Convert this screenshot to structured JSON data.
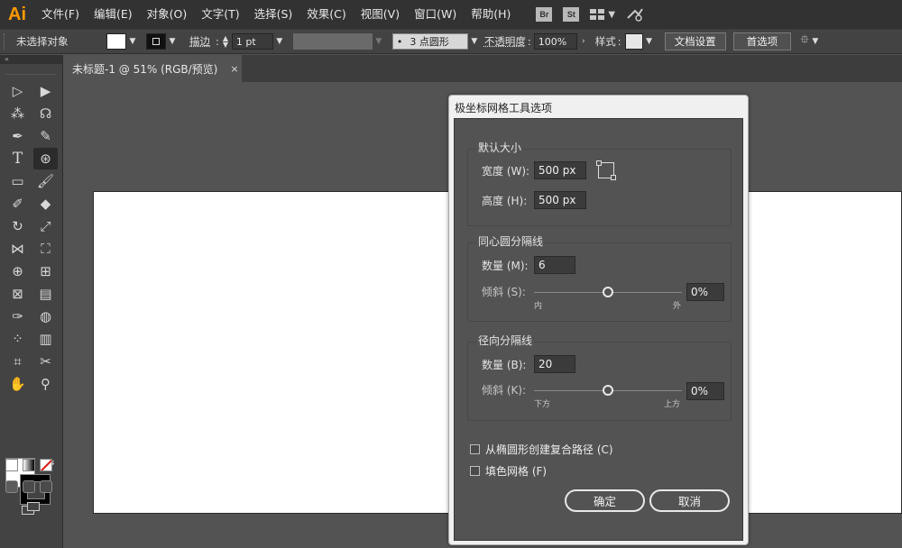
{
  "app": {
    "logo": "Ai"
  },
  "menu": [
    "文件(F)",
    "编辑(E)",
    "对象(O)",
    "文字(T)",
    "选择(S)",
    "效果(C)",
    "视图(V)",
    "窗口(W)",
    "帮助(H)"
  ],
  "menu_badges": {
    "bridge": "Br",
    "stock": "St"
  },
  "control": {
    "selection_status": "未选择对象",
    "stroke_label": "描边",
    "stroke_weight": "1 pt",
    "brush_profile": "3 点圆形",
    "brush_dot": "•",
    "opacity_label": "不透明度",
    "opacity_value": "100%",
    "style_label": "样式",
    "doc_setup_button": "文档设置",
    "preferences_button": "首选项"
  },
  "tab": {
    "title": "未标题-1 @ 51% (RGB/预览)",
    "close": "×"
  },
  "dialog": {
    "title": "极坐标网格工具选项",
    "default_size": {
      "title": "默认大小",
      "width_label": "宽度 (W):",
      "width_value": "500 px",
      "height_label": "高度 (H):",
      "height_value": "500 px"
    },
    "concentric": {
      "title": "同心圆分隔线",
      "count_label": "数量 (M):",
      "count_value": "6",
      "skew_label": "倾斜 (S):",
      "skew_value": "0%",
      "skew_min_label": "内",
      "skew_max_label": "外",
      "skew_position": 0.5
    },
    "radial": {
      "title": "径向分隔线",
      "count_label": "数量 (B):",
      "count_value": "20",
      "skew_label": "倾斜 (K):",
      "skew_value": "0%",
      "skew_min_label": "下方",
      "skew_max_label": "上方",
      "skew_position": 0.5
    },
    "compound_path_label": "从椭圆形创建复合路径 (C)",
    "compound_path_checked": false,
    "fill_grid_label": "填色网格 (F)",
    "fill_grid_checked": false,
    "ok_button": "确定",
    "cancel_button": "取消"
  }
}
